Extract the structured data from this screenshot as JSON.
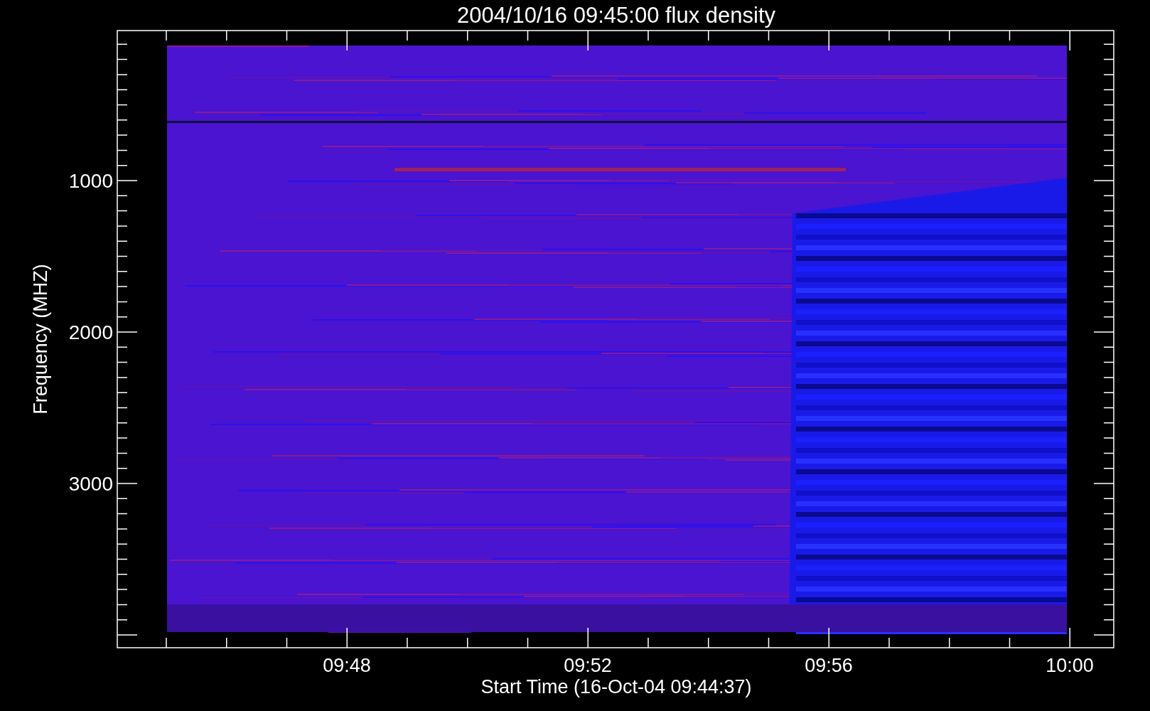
{
  "title": "2004/10/16 09:45:00 flux density",
  "y_axis": {
    "label": "Frequency (MHZ)",
    "tick_labels": [
      "1000",
      "2000",
      "3000"
    ]
  },
  "x_axis": {
    "label": "Start Time (16-Oct-04 09:44:37)",
    "tick_labels": [
      "09:48",
      "09:52",
      "09:56",
      "10:00"
    ]
  }
}
